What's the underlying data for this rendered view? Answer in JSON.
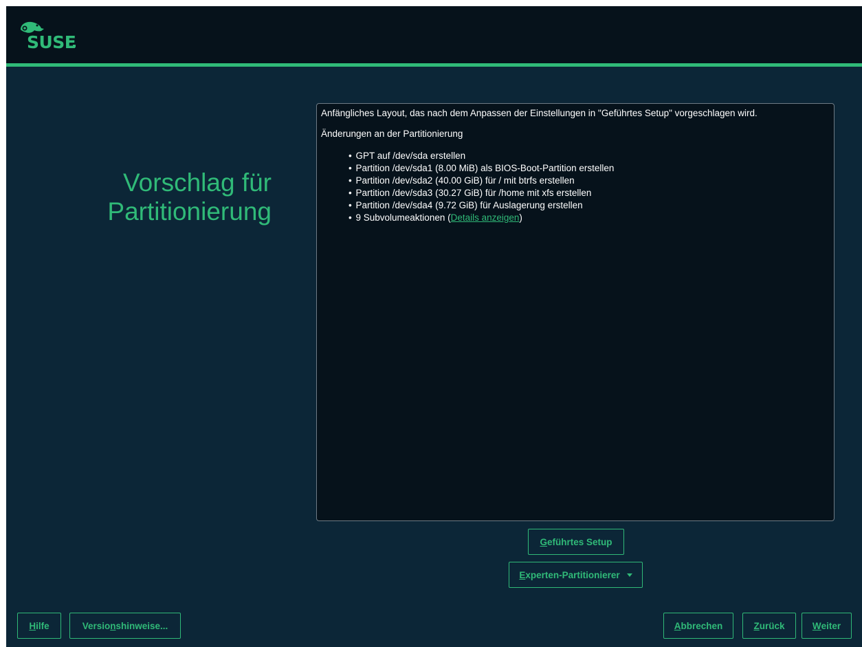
{
  "header": {
    "logo_text": "SUSE",
    "accent_color": "#30ba78"
  },
  "page": {
    "title_line1": "Vorschlag für",
    "title_line2": "Partitionierung"
  },
  "proposal": {
    "intro": "Anfängliches Layout, das nach dem Anpassen der Einstellungen in \"Geführtes Setup\" vorgeschlagen wird.",
    "heading": "Änderungen an der Partitionierung",
    "bullet": "•",
    "items": [
      "GPT auf /dev/sda erstellen",
      "Partition /dev/sda1 (8.00 MiB) als BIOS-Boot-Partition erstellen",
      "Partition /dev/sda2 (40.00 GiB) für / mit btrfs erstellen",
      "Partition /dev/sda3 (30.27 GiB) für /home mit xfs erstellen",
      "Partition /dev/sda4 (9.72 GiB) für Auslagerung erstellen"
    ],
    "subvol_prefix": "9 Subvolumeaktionen (",
    "subvol_link": "Details anzeigen",
    "subvol_suffix": ")"
  },
  "buttons": {
    "guided_setup": {
      "mnemonic": "G",
      "rest": "eführtes Setup"
    },
    "expert_partitioner": {
      "mnemonic": "E",
      "rest": "xperten-Partitionierer",
      "icon": "caret-down-icon"
    },
    "help": {
      "mnemonic": "H",
      "rest": "ilfe"
    },
    "release_notes": {
      "before": "Versio",
      "mnemonic": "n",
      "rest": "shinweise..."
    },
    "abort": {
      "mnemonic": "A",
      "rest": "bbrechen"
    },
    "back": {
      "mnemonic": "Z",
      "rest": "urück"
    },
    "next": {
      "mnemonic": "W",
      "rest": "eiter"
    }
  }
}
